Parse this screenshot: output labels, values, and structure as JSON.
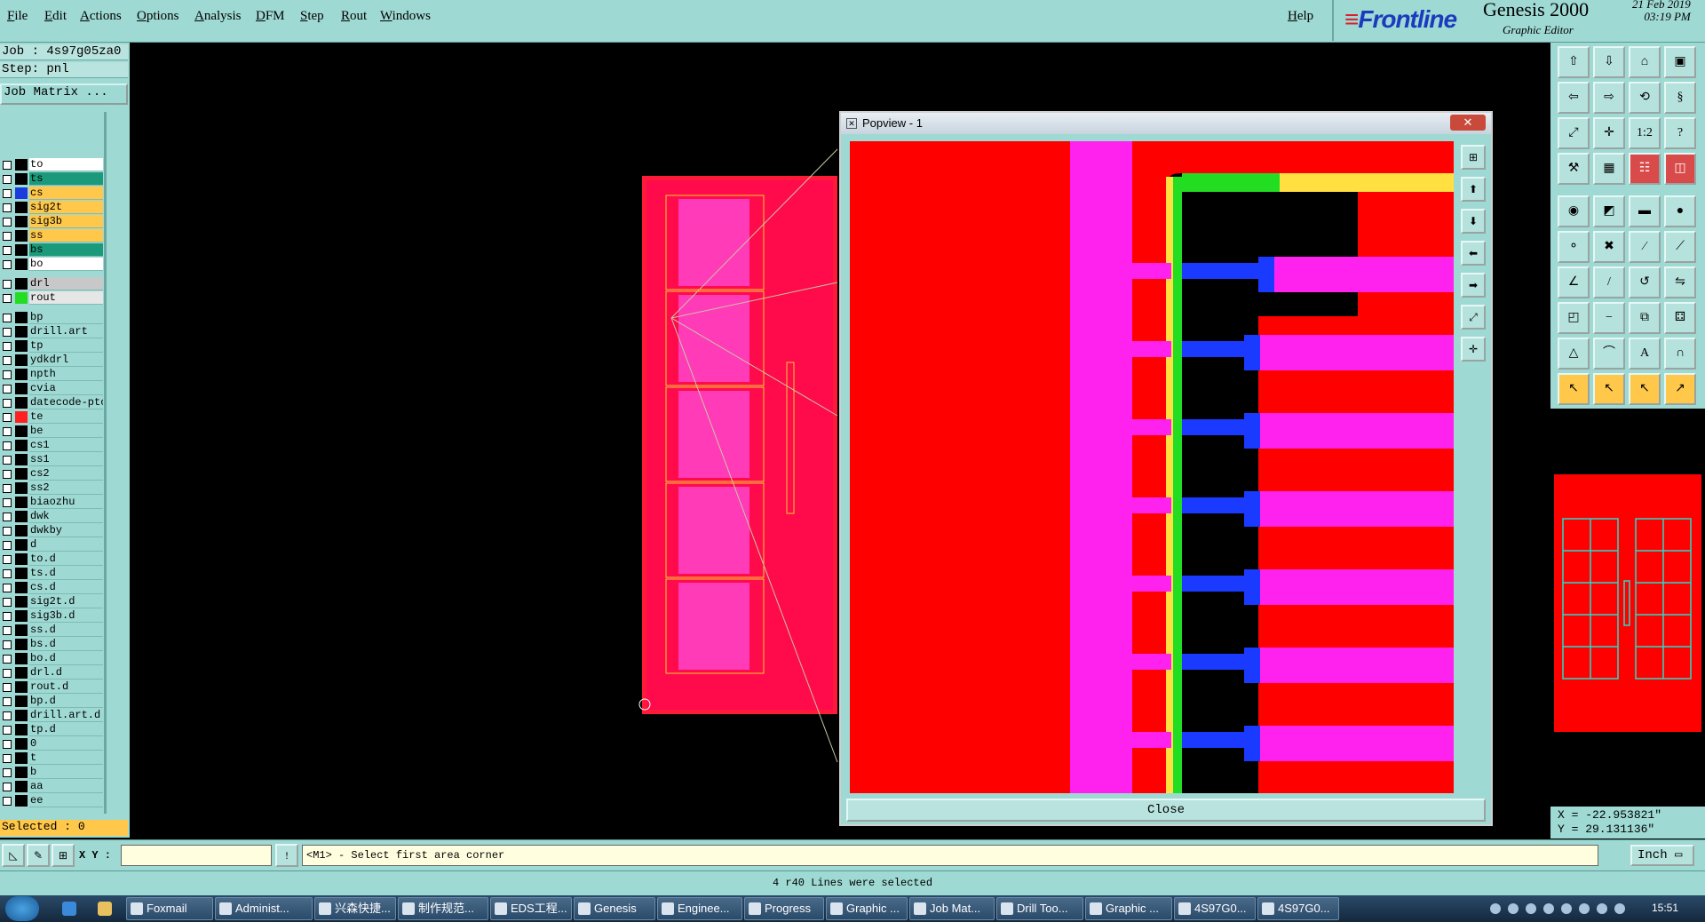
{
  "menu": {
    "items": [
      "File",
      "Edit",
      "Actions",
      "Options",
      "Analysis",
      "DFM",
      "Step",
      "Rout",
      "Windows"
    ],
    "help": "Help"
  },
  "brand": {
    "logo": "Frontline",
    "product": "Genesis 2000",
    "subtitle": "Graphic Editor",
    "date": "21 Feb 2019",
    "time": "03:19 PM"
  },
  "job": {
    "job_line": "Job : 4s97g05za0",
    "step_line": "Step: pnl",
    "matrix_button": "Job Matrix ...",
    "selected_line": "Selected : 0"
  },
  "layers": [
    {
      "name": "to",
      "color": "#ffffff",
      "swatch": "#000000",
      "bg": "#ffffff"
    },
    {
      "name": "ts",
      "color": "#1a9a7a",
      "swatch": "#000000",
      "bg": "#1a9a7a"
    },
    {
      "name": "cs",
      "color": "#ffc84a",
      "swatch": "#1a3bdd",
      "bg": "#ffc84a"
    },
    {
      "name": "sig2t",
      "color": "#ffc84a",
      "swatch": "#000000",
      "bg": "#ffc84a"
    },
    {
      "name": "sig3b",
      "color": "#ffc84a",
      "swatch": "#000000",
      "bg": "#ffc84a"
    },
    {
      "name": "ss",
      "color": "#ffc84a",
      "swatch": "#000000",
      "bg": "#ffc84a"
    },
    {
      "name": "bs",
      "color": "#1a9a7a",
      "swatch": "#000000",
      "bg": "#1a9a7a"
    },
    {
      "name": "bo",
      "color": "#ffffff",
      "swatch": "#000000",
      "bg": "#ffffff"
    },
    {
      "name": "drl",
      "color": "#c8c8c8",
      "swatch": "#000000",
      "bg": "#c8c8c8"
    },
    {
      "name": "rout",
      "color": "#e6e6e6",
      "swatch": "#22dd22",
      "bg": "#e6e6e6"
    },
    {
      "name": "bp",
      "color": "",
      "swatch": "#000000",
      "bg": ""
    },
    {
      "name": "drill.art",
      "color": "",
      "swatch": "#000000",
      "bg": ""
    },
    {
      "name": "tp",
      "color": "",
      "swatch": "#000000",
      "bg": ""
    },
    {
      "name": "ydkdrl",
      "color": "",
      "swatch": "#000000",
      "bg": ""
    },
    {
      "name": "npth",
      "color": "",
      "swatch": "#000000",
      "bg": ""
    },
    {
      "name": "cvia",
      "color": "",
      "swatch": "#000000",
      "bg": ""
    },
    {
      "name": "datecode-ptc",
      "color": "",
      "swatch": "#000000",
      "bg": ""
    },
    {
      "name": "te",
      "color": "",
      "swatch": "#ff2020",
      "bg": ""
    },
    {
      "name": "be",
      "color": "",
      "swatch": "#000000",
      "bg": ""
    },
    {
      "name": "cs1",
      "color": "",
      "swatch": "#000000",
      "bg": ""
    },
    {
      "name": "ss1",
      "color": "",
      "swatch": "#000000",
      "bg": ""
    },
    {
      "name": "cs2",
      "color": "",
      "swatch": "#000000",
      "bg": ""
    },
    {
      "name": "ss2",
      "color": "",
      "swatch": "#000000",
      "bg": ""
    },
    {
      "name": "biaozhu",
      "color": "",
      "swatch": "#000000",
      "bg": ""
    },
    {
      "name": "dwk",
      "color": "",
      "swatch": "#000000",
      "bg": ""
    },
    {
      "name": "dwkby",
      "color": "",
      "swatch": "#000000",
      "bg": ""
    },
    {
      "name": "d",
      "color": "",
      "swatch": "#000000",
      "bg": ""
    },
    {
      "name": "to.d",
      "color": "",
      "swatch": "#000000",
      "bg": ""
    },
    {
      "name": "ts.d",
      "color": "",
      "swatch": "#000000",
      "bg": ""
    },
    {
      "name": "cs.d",
      "color": "",
      "swatch": "#000000",
      "bg": ""
    },
    {
      "name": "sig2t.d",
      "color": "",
      "swatch": "#000000",
      "bg": ""
    },
    {
      "name": "sig3b.d",
      "color": "",
      "swatch": "#000000",
      "bg": ""
    },
    {
      "name": "ss.d",
      "color": "",
      "swatch": "#000000",
      "bg": ""
    },
    {
      "name": "bs.d",
      "color": "",
      "swatch": "#000000",
      "bg": ""
    },
    {
      "name": "bo.d",
      "color": "",
      "swatch": "#000000",
      "bg": ""
    },
    {
      "name": "drl.d",
      "color": "",
      "swatch": "#000000",
      "bg": ""
    },
    {
      "name": "rout.d",
      "color": "",
      "swatch": "#000000",
      "bg": ""
    },
    {
      "name": "bp.d",
      "color": "",
      "swatch": "#000000",
      "bg": ""
    },
    {
      "name": "drill.art.d",
      "color": "",
      "swatch": "#000000",
      "bg": ""
    },
    {
      "name": "tp.d",
      "color": "",
      "swatch": "#000000",
      "bg": ""
    },
    {
      "name": "0",
      "color": "",
      "swatch": "#000000",
      "bg": ""
    },
    {
      "name": "t",
      "color": "",
      "swatch": "#000000",
      "bg": ""
    },
    {
      "name": "b",
      "color": "",
      "swatch": "#000000",
      "bg": ""
    },
    {
      "name": "aa",
      "color": "",
      "swatch": "#000000",
      "bg": ""
    },
    {
      "name": "ee",
      "color": "",
      "swatch": "#000000",
      "bg": ""
    }
  ],
  "popview": {
    "title": "Popview - 1",
    "close_label": "Close"
  },
  "coords": {
    "x": "X = -22.953821\"",
    "y": "Y = 29.131136\""
  },
  "command": {
    "xy_label": "X Y :",
    "xy_value": "",
    "prompt": "<M1> - Select first area corner",
    "units": "Inch"
  },
  "status": "4 r40 Lines were selected",
  "taskbar": {
    "tasks": [
      "Foxmail",
      "Administ...",
      "兴森快捷...",
      "制作规范...",
      "EDS工程...",
      "Genesis",
      "Enginee...",
      "Progress",
      "Graphic ...",
      "Job Mat...",
      "Drill Too...",
      "Graphic ...",
      "4S97G0...",
      "4S97G0..."
    ],
    "clock": "15:51"
  }
}
